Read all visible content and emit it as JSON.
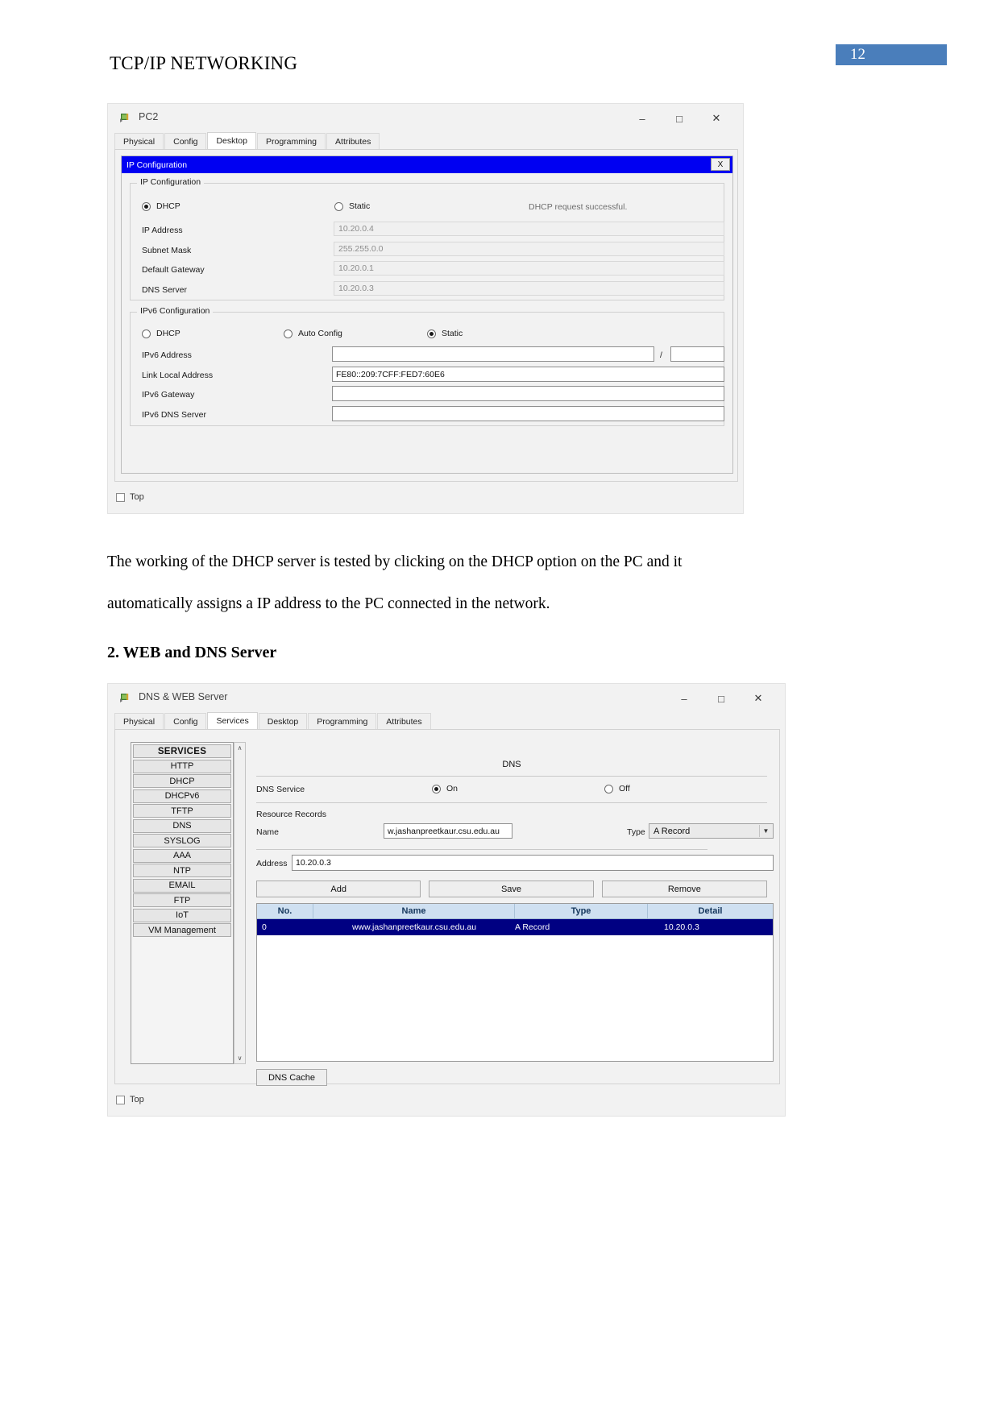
{
  "document": {
    "header_title": "TCP/IP NETWORKING",
    "page_number": "12",
    "accent_color": "#4a7ebb"
  },
  "pc2_window": {
    "title": "PC2",
    "icon": "packet-tracer-device-icon",
    "window_controls": {
      "minimize": "–",
      "maximize": "□",
      "close": "✕"
    },
    "tabs": [
      {
        "label": "Physical",
        "active": false
      },
      {
        "label": "Config",
        "active": false
      },
      {
        "label": "Desktop",
        "active": true
      },
      {
        "label": "Programming",
        "active": false
      },
      {
        "label": "Attributes",
        "active": false
      }
    ],
    "applet": {
      "titlebar": "IP Configuration",
      "close_label": "X",
      "ipv4_group": "IP Configuration",
      "mode_dhcp": "DHCP",
      "mode_static": "Static",
      "mode_selected": "DHCP",
      "status_message": "DHCP request successful.",
      "fields": [
        {
          "label": "IP Address",
          "value": "10.20.0.4"
        },
        {
          "label": "Subnet Mask",
          "value": "255.255.0.0"
        },
        {
          "label": "Default Gateway",
          "value": "10.20.0.1"
        },
        {
          "label": "DNS Server",
          "value": "10.20.0.3"
        }
      ],
      "ipv6_group": "IPv6 Configuration",
      "ipv6_mode_dhcp": "DHCP",
      "ipv6_mode_auto": "Auto Config",
      "ipv6_mode_static": "Static",
      "ipv6_mode_selected": "Static",
      "ipv6_address_label": "IPv6 Address",
      "ipv6_address_value": "",
      "ipv6_prefix_separator": "/",
      "ipv6_prefix_value": "",
      "link_local_label": "Link Local Address",
      "link_local_value": "FE80::209:7CFF:FED7:60E6",
      "ipv6_gateway_label": "IPv6 Gateway",
      "ipv6_gateway_value": "",
      "ipv6_dns_label": "IPv6 DNS Server",
      "ipv6_dns_value": ""
    },
    "footer_checkbox": "Top"
  },
  "paragraph_1": "The working of the DHCP server is tested by clicking on the DHCP option on the PC and it",
  "paragraph_2": "automatically assigns a IP address to the PC connected in the network.",
  "section_heading": "2. WEB and DNS Server",
  "server_window": {
    "title": "DNS & WEB Server",
    "icon": "packet-tracer-device-icon",
    "window_controls": {
      "minimize": "–",
      "maximize": "□",
      "close": "✕"
    },
    "tabs": [
      {
        "label": "Physical",
        "active": false
      },
      {
        "label": "Config",
        "active": false
      },
      {
        "label": "Services",
        "active": true
      },
      {
        "label": "Desktop",
        "active": false
      },
      {
        "label": "Programming",
        "active": false
      },
      {
        "label": "Attributes",
        "active": false
      }
    ],
    "services_list": [
      "SERVICES",
      "HTTP",
      "DHCP",
      "DHCPv6",
      "TFTP",
      "DNS",
      "SYSLOG",
      "AAA",
      "NTP",
      "EMAIL",
      "FTP",
      "IoT",
      "VM Management"
    ],
    "scroll_up": "∧",
    "scroll_down": "∨",
    "dns_panel": {
      "title": "DNS",
      "service_label": "DNS Service",
      "on_label": "On",
      "off_label": "Off",
      "service_state": "On",
      "resource_records_label": "Resource Records",
      "name_label": "Name",
      "name_value": "w.jashanpreetkaur.csu.edu.au",
      "type_label": "Type",
      "type_value": "A Record",
      "address_label": "Address",
      "address_value": "10.20.0.3",
      "add_label": "Add",
      "save_label": "Save",
      "remove_label": "Remove",
      "table_headers": [
        "No.",
        "Name",
        "Type",
        "Detail"
      ],
      "table_rows": [
        {
          "no": "0",
          "name": "www.jashanpreetkaur.csu.edu.au",
          "type": "A Record",
          "detail": "10.20.0.3"
        }
      ],
      "dns_cache_label": "DNS Cache"
    },
    "footer_checkbox": "Top"
  }
}
